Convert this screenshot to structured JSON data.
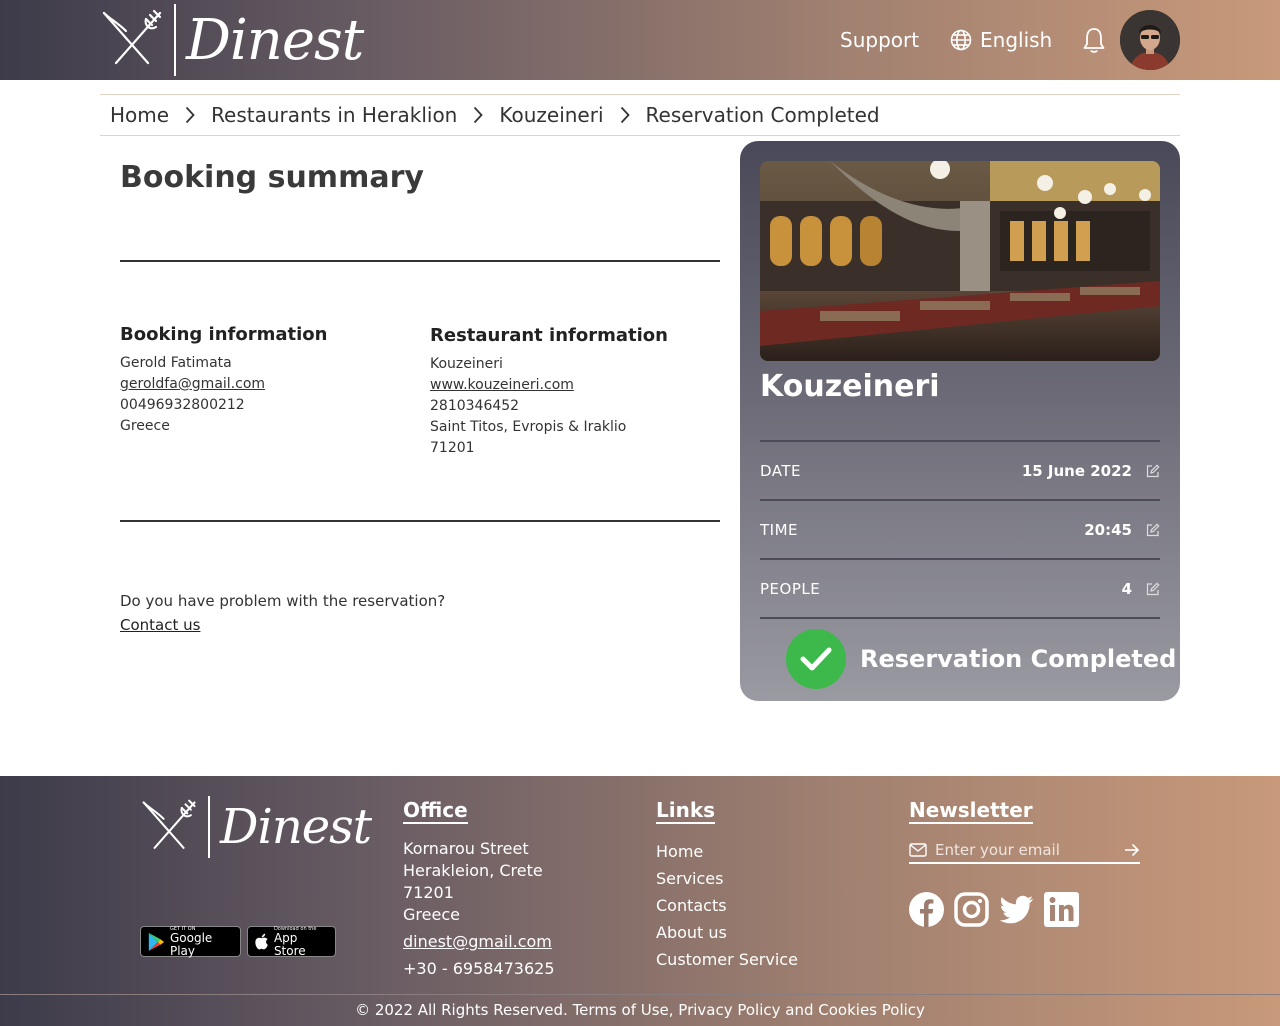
{
  "brand": {
    "name": "Dinest"
  },
  "header": {
    "support": "Support",
    "language": "English"
  },
  "breadcrumb": [
    "Home",
    "Restaurants in Heraklion",
    "Kouzeineri",
    "Reservation Completed"
  ],
  "summary": {
    "title": "Booking summary",
    "booking": {
      "heading": "Booking information",
      "name": "Gerold Fatimata",
      "email": "geroldfa@gmail.com",
      "phone": "00496932800212",
      "country": "Greece"
    },
    "restaurant": {
      "heading": "Restaurant information",
      "name": "Kouzeineri",
      "website": "www.kouzeineri.com",
      "phone": "2810346452",
      "address": "Saint Titos, Evropis & Iraklio",
      "postcode": "71201"
    },
    "problem_text": "Do you have problem with the reservation?",
    "contact_link": "Contact us"
  },
  "card": {
    "restaurant": "Kouzeineri",
    "rows": [
      {
        "label": "DATE",
        "value": "15 June  2022"
      },
      {
        "label": "TIME",
        "value": "20:45"
      },
      {
        "label": "PEOPLE",
        "value": "4"
      }
    ],
    "status": "Reservation Completed",
    "status_color": "#3cb94a"
  },
  "footer": {
    "stores": {
      "google_small": "GET IT ON",
      "google_big": "Google Play",
      "apple_small": "Download on the",
      "apple_big": "App Store"
    },
    "office": {
      "heading": "Office",
      "street": "Kornarou Street",
      "city": "Herakleion, Crete",
      "postcode": "71201",
      "country": "Greece",
      "email": "dinest@gmail.com",
      "phone": "+30 - 6958473625"
    },
    "links": {
      "heading": "Links",
      "items": [
        "Home",
        "Services",
        "Contacts",
        "About us",
        "Customer Service"
      ]
    },
    "newsletter": {
      "heading": "Newsletter",
      "placeholder": "Enter your email",
      "socials": [
        "facebook-icon",
        "instagram-icon",
        "twitter-icon",
        "linkedin-icon"
      ]
    },
    "copyright": "© 2022 All Rights Reserved. Terms of Use, Privacy Policy and Cookies Policy"
  }
}
